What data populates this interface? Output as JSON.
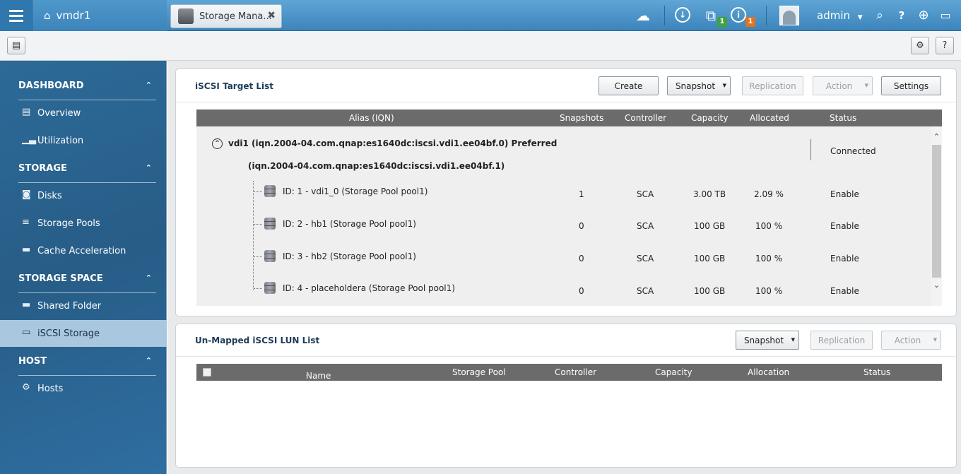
{
  "topbar": {
    "home_label": "vmdr1",
    "app_tab_label": "Storage Mana...",
    "close_glyph": "✖",
    "badge_counts": [
      "1",
      "1"
    ],
    "user_name": "admin",
    "icons": [
      "menu-icon",
      "home-icon",
      "storage-manager-icon",
      "cloud-icon",
      "clock-icon",
      "device-icon",
      "info-icon",
      "avatar-icon",
      "search-icon",
      "help-icon",
      "globe-icon",
      "monitor-icon"
    ]
  },
  "sidebar": {
    "sections": [
      {
        "title": "DASHBOARD",
        "items": [
          {
            "label": "Overview",
            "icon": "overview-icon"
          },
          {
            "label": "Utilization",
            "icon": "chart-icon"
          }
        ]
      },
      {
        "title": "STORAGE",
        "items": [
          {
            "label": "Disks",
            "icon": "disk-icon"
          },
          {
            "label": "Storage Pools",
            "icon": "pool-icon"
          },
          {
            "label": "Cache Acceleration",
            "icon": "cache-icon"
          }
        ]
      },
      {
        "title": "STORAGE SPACE",
        "items": [
          {
            "label": "Shared Folder",
            "icon": "folder-icon"
          },
          {
            "label": "iSCSI Storage",
            "icon": "iscsi-icon",
            "active": true
          }
        ]
      },
      {
        "title": "HOST",
        "items": [
          {
            "label": "Hosts",
            "icon": "gear-icon"
          }
        ]
      }
    ]
  },
  "target_panel": {
    "title": "iSCSI Target List",
    "buttons": {
      "create": "Create",
      "snapshot": "Snapshot",
      "replication": "Replication",
      "action": "Action",
      "settings": "Settings"
    },
    "columns": [
      "Alias (IQN)",
      "Snapshots",
      "Controller",
      "Capacity",
      "Allocated",
      "Status"
    ],
    "target": {
      "line1": "vdi1 (iqn.2004-04.com.qnap:es1640dc:iscsi.vdi1.ee04bf.0) Preferred",
      "line2": "(iqn.2004-04.com.qnap:es1640dc:iscsi.vdi1.ee04bf.1)",
      "status": "Connected"
    },
    "luns": [
      {
        "name": "ID: 1 - vdi1_0 (Storage Pool pool1)",
        "snapshots": "1",
        "controller": "SCA",
        "capacity": "3.00 TB",
        "allocated": "2.09 %",
        "status": "Enable"
      },
      {
        "name": "ID: 2 - hb1 (Storage Pool pool1)",
        "snapshots": "0",
        "controller": "SCA",
        "capacity": "100 GB",
        "allocated": "100 %",
        "status": "Enable"
      },
      {
        "name": "ID: 3 - hb2 (Storage Pool pool1)",
        "snapshots": "0",
        "controller": "SCA",
        "capacity": "100 GB",
        "allocated": "100 %",
        "status": "Enable"
      },
      {
        "name": "ID: 4 - placeholdera (Storage Pool pool1)",
        "snapshots": "0",
        "controller": "SCA",
        "capacity": "100 GB",
        "allocated": "100 %",
        "status": "Enable"
      }
    ]
  },
  "unmapped_panel": {
    "title": "Un-Mapped iSCSI LUN List",
    "buttons": {
      "snapshot": "Snapshot",
      "replication": "Replication",
      "action": "Action"
    },
    "columns": [
      "Name",
      "Storage Pool",
      "Controller",
      "Capacity",
      "Allocation",
      "Status"
    ],
    "sort_glyph": "▲"
  },
  "glyphs": {
    "collapse": "⌃",
    "dropdown": "▼",
    "up": "⌃",
    "down": "⌄",
    "toggle": "⌃"
  },
  "colors": {
    "sidebar": "#2d6a98",
    "topbar": "#3c84bb",
    "active_item": "#a9c8e0",
    "header": "#6b6b6b"
  }
}
